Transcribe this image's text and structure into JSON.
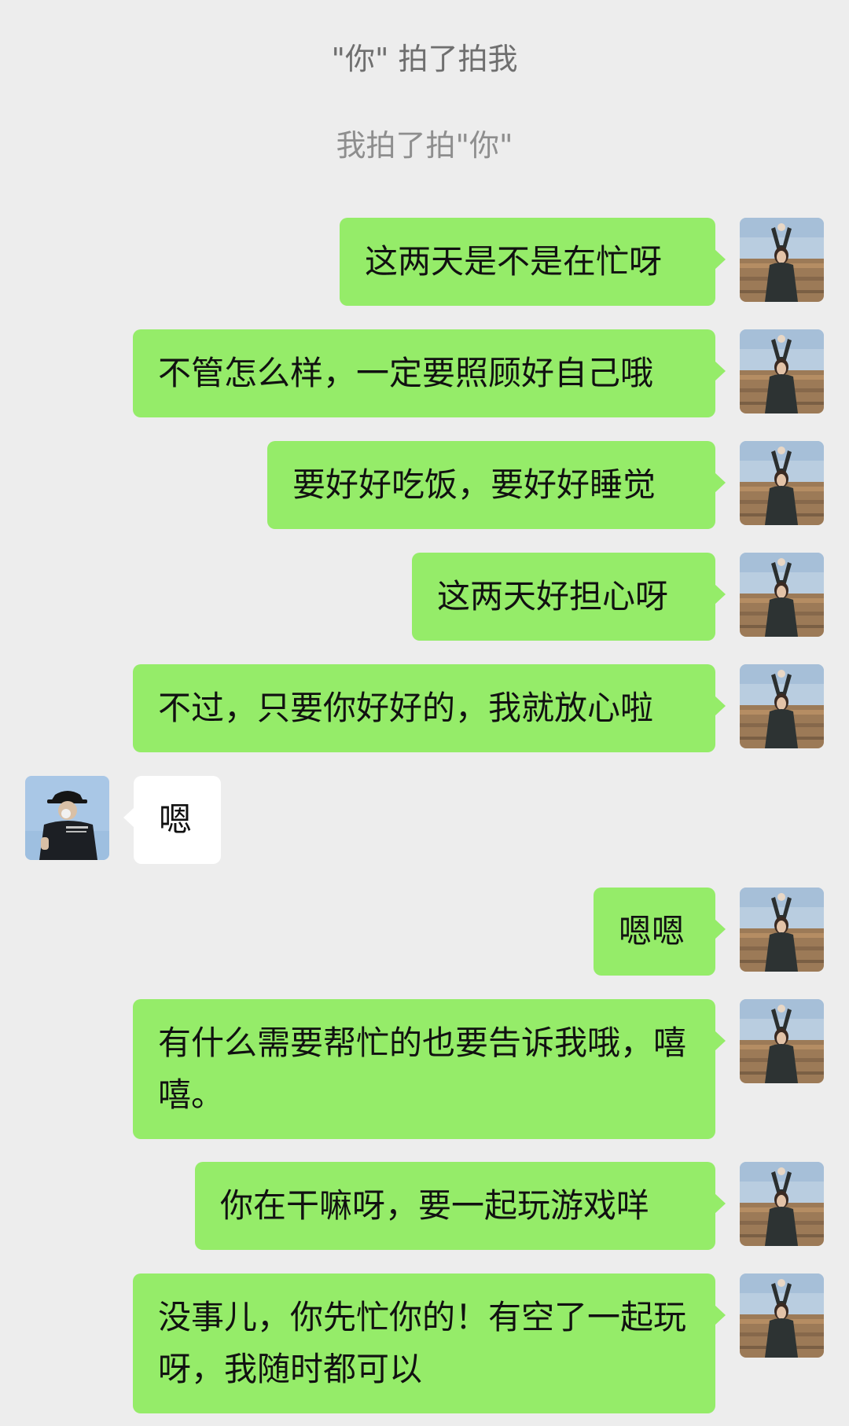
{
  "system": {
    "pat_received": "\"你\" 拍了拍我",
    "pat_sent": "我拍了拍\"你\""
  },
  "messages": [
    {
      "text": "这两天是不是在忙呀"
    },
    {
      "text": "不管怎么样，一定要照顾好自己哦"
    },
    {
      "text": "要好好吃饭，要好好睡觉"
    },
    {
      "text": "这两天好担心呀"
    },
    {
      "text": "不过，只要你好好的，我就放心啦"
    },
    {
      "text": "嗯"
    },
    {
      "text": "嗯嗯"
    },
    {
      "text": "有什么需要帮忙的也要告诉我哦，嘻嘻。"
    },
    {
      "text": "你在干嘛呀，要一起玩游戏咩"
    },
    {
      "text": "没事儿，你先忙你的！有空了一起玩呀，我随时都可以"
    }
  ],
  "colors": {
    "background": "#ededed",
    "my_bubble": "#95ec69",
    "their_bubble": "#ffffff",
    "system_text": "#8e8e8e"
  },
  "icons": {
    "my_avatar": "avatar-girl-field-photo",
    "their_avatar": "avatar-man-hat-photo"
  }
}
